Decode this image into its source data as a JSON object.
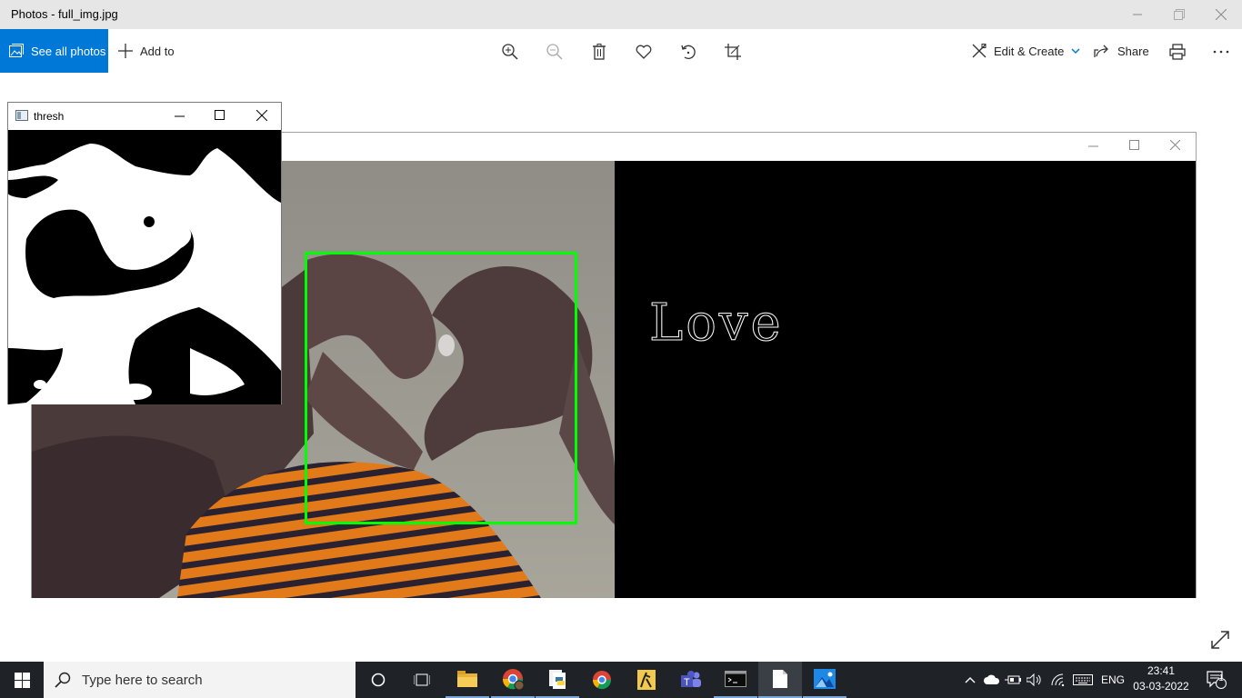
{
  "app": {
    "title": "Photos - full_img.jpg"
  },
  "toolbar": {
    "see_all_label": "See all photos",
    "add_to_label": "Add to",
    "edit_create_label": "Edit & Create",
    "share_label": "Share",
    "accent": "#0078d7"
  },
  "thresh_window": {
    "title": "thresh"
  },
  "image_content": {
    "gesture_label": "Love",
    "roi_color": "#00ff00"
  },
  "taskbar": {
    "search_placeholder": "Type here to search",
    "language": "ENG",
    "time": "23:41",
    "date": "03-03-2022",
    "notification_count": "1",
    "pinned_icons": [
      "cortana-icon",
      "task-view-icon",
      "file-explorer-icon",
      "chrome-profile-icon",
      "python-files-icon",
      "chrome-icon",
      "game-icon",
      "teams-icon",
      "terminal-icon",
      "notepad-icon",
      "photos-icon"
    ]
  }
}
